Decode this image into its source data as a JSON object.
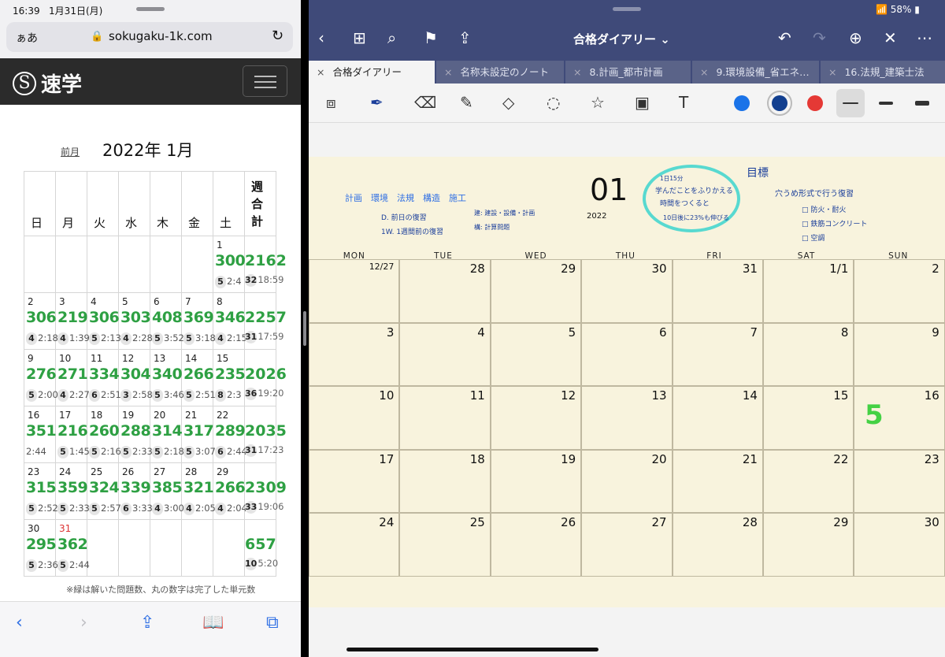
{
  "left": {
    "status": {
      "time": "16:39",
      "date": "1月31日(月)"
    },
    "url_bar": {
      "text_size": "ぁあ",
      "url": "sokugaku-1k.com"
    },
    "site": {
      "logo_mark": "S",
      "logo_text": "速学"
    },
    "calendar": {
      "prev_label": "前月",
      "month_title": "2022年 1月",
      "weekday_headers": [
        "日",
        "月",
        "火",
        "水",
        "木",
        "金",
        "土",
        "週合計"
      ],
      "weeks": [
        {
          "days": [
            null,
            null,
            null,
            null,
            null,
            null,
            {
              "day": "1",
              "count": "300",
              "done": "5",
              "time": "2:4"
            }
          ],
          "total": "2162",
          "total_done": "32",
          "total_time": "18:59"
        },
        {
          "days": [
            {
              "day": "2",
              "count": "306",
              "done": "4",
              "time": "2:18"
            },
            {
              "day": "3",
              "count": "219",
              "done": "4",
              "time": "1:39"
            },
            {
              "day": "4",
              "count": "306",
              "done": "5",
              "time": "2:13"
            },
            {
              "day": "5",
              "count": "303",
              "done": "4",
              "time": "2:28"
            },
            {
              "day": "6",
              "count": "408",
              "done": "5",
              "time": "3:52"
            },
            {
              "day": "7",
              "count": "369",
              "done": "5",
              "time": "3:18"
            },
            {
              "day": "8",
              "count": "346",
              "done": "4",
              "time": "2:15"
            }
          ],
          "total": "2257",
          "total_done": "31",
          "total_time": "17:59"
        },
        {
          "days": [
            {
              "day": "9",
              "count": "276",
              "done": "5",
              "time": "2:00"
            },
            {
              "day": "10",
              "count": "271",
              "done": "4",
              "time": "2:27"
            },
            {
              "day": "11",
              "count": "334",
              "done": "6",
              "time": "2:51"
            },
            {
              "day": "12",
              "count": "304",
              "done": "3",
              "time": "2:58"
            },
            {
              "day": "13",
              "count": "340",
              "done": "5",
              "time": "3:46"
            },
            {
              "day": "14",
              "count": "266",
              "done": "5",
              "time": "2:51"
            },
            {
              "day": "15",
              "count": "235",
              "done": "8",
              "time": "2:3"
            }
          ],
          "total": "2026",
          "total_done": "36",
          "total_time": "19:20"
        },
        {
          "days": [
            {
              "day": "16",
              "count": "351",
              "done": "",
              "time": "2:44"
            },
            {
              "day": "17",
              "count": "216",
              "done": "5",
              "time": "1:45"
            },
            {
              "day": "18",
              "count": "260",
              "done": "5",
              "time": "2:16"
            },
            {
              "day": "19",
              "count": "288",
              "done": "5",
              "time": "2:33"
            },
            {
              "day": "20",
              "count": "314",
              "done": "5",
              "time": "2:18"
            },
            {
              "day": "21",
              "count": "317",
              "done": "5",
              "time": "3:07"
            },
            {
              "day": "22",
              "count": "289",
              "done": "6",
              "time": "2:44"
            }
          ],
          "total": "2035",
          "total_done": "31",
          "total_time": "17:23"
        },
        {
          "days": [
            {
              "day": "23",
              "count": "315",
              "done": "5",
              "time": "2:52"
            },
            {
              "day": "24",
              "count": "359",
              "done": "5",
              "time": "2:33"
            },
            {
              "day": "25",
              "count": "324",
              "done": "5",
              "time": "2:57"
            },
            {
              "day": "26",
              "count": "339",
              "done": "6",
              "time": "3:33"
            },
            {
              "day": "27",
              "count": "385",
              "done": "4",
              "time": "3:00"
            },
            {
              "day": "28",
              "count": "321",
              "done": "4",
              "time": "2:05"
            },
            {
              "day": "29",
              "count": "266",
              "done": "4",
              "time": "2:04"
            }
          ],
          "total": "2309",
          "total_done": "33",
          "total_time": "19:06"
        },
        {
          "days": [
            {
              "day": "30",
              "count": "295",
              "done": "5",
              "time": "2:36"
            },
            {
              "day": "31",
              "count": "362",
              "done": "5",
              "time": "2:44",
              "red": true
            },
            null,
            null,
            null,
            null,
            null
          ],
          "total": "657",
          "total_done": "10",
          "total_time": "5:20"
        }
      ],
      "note": "※緑は解いた問題数、丸の数字は完了した単元数"
    }
  },
  "right": {
    "status": {
      "battery": "58%"
    },
    "title": "合格ダイアリー ⌄",
    "tabs": [
      "合格ダイアリー",
      "名称未設定のノート",
      "8.計画_都市計画",
      "9.環境設備_省エネ…",
      "16.法規_建築士法"
    ],
    "page": {
      "month_number": "01",
      "year": "2022",
      "subjects": "計画　環境　法規　構造　施工",
      "legend": [
        "D. 前日の復習",
        "1W. 1週間前の復習",
        "建: 建設・設備・計画",
        "構: 計算問題"
      ],
      "circle_note": [
        "1日15分",
        "学んだことをふりかえる",
        "時間をつくると",
        "10日後に23%も伸びる"
      ],
      "goal_title": "目標",
      "goal_lines": [
        "穴うめ形式で行う復習",
        "□ 防火・耐火",
        "□ 鉄筋コンクリート",
        "□ 空調"
      ],
      "weekday_labels": [
        "MON",
        "TUE",
        "WED",
        "THU",
        "FRI",
        "SAT",
        "SUN"
      ],
      "day_numbers": [
        [
          "12/27",
          "28",
          "29",
          "30",
          "31",
          "1/1",
          "2"
        ],
        [
          "3",
          "4",
          "5",
          "6",
          "7",
          "8",
          "9"
        ],
        [
          "10",
          "11",
          "12",
          "13",
          "14",
          "15",
          "16"
        ],
        [
          "17",
          "18",
          "19",
          "20",
          "21",
          "22",
          "23"
        ],
        [
          "24",
          "25",
          "26",
          "27",
          "28",
          "29",
          "30"
        ]
      ],
      "big_mark": "5"
    }
  },
  "bottom_icons": [
    "back-icon",
    "forward-icon",
    "share-icon",
    "bookmarks-icon",
    "tabs-icon"
  ]
}
